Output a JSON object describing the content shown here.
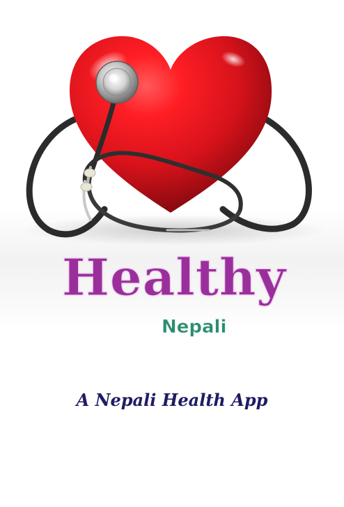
{
  "splash": {
    "title": "Healthy",
    "subtitle": "Nepali",
    "tagline": "A Nepali Health App"
  },
  "icons": {
    "hero": "heart-stethoscope-icon"
  },
  "colors": {
    "title": "#9a2f9c",
    "subtitle": "#2c8b6f",
    "tagline": "#1f1b63",
    "heart": "#d7121b"
  }
}
